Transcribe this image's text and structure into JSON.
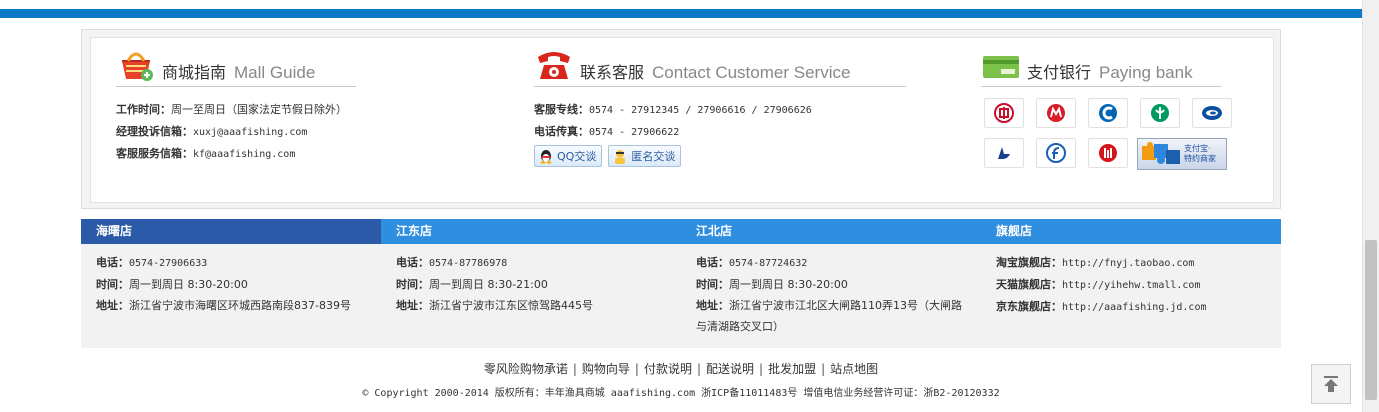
{
  "guide": {
    "title_cn": "商城指南",
    "title_en": "Mall Guide",
    "rows": [
      {
        "label": "工作时间：",
        "value": "周一至周日（国家法定节假日除外）"
      },
      {
        "label": "经理投诉信箱：",
        "value": "xuxj@aaafishing.com"
      },
      {
        "label": "客服服务信箱：",
        "value": "kf@aaafishing.com"
      }
    ]
  },
  "service": {
    "title_cn": "联系客服",
    "title_en": "Contact Customer Service",
    "rows": [
      {
        "label": "客服专线：",
        "value": "0574 - 27912345 / 27906616 / 27906626"
      },
      {
        "label": "电话传真：",
        "value": "0574 - 27906622"
      }
    ],
    "qq_button": "QQ交谈",
    "anon_button": "匿名交谈"
  },
  "pay": {
    "title_cn": "支付银行",
    "title_en": "Paying bank",
    "alipay_line1": "支付宝·",
    "alipay_line2": "特约商家"
  },
  "stores": {
    "tabs": [
      "海曙店",
      "江东店",
      "江北店",
      "旗舰店"
    ],
    "haishu": {
      "phone_label": "电话：",
      "phone": "0574-27906633",
      "time_label": "时间：",
      "time": "周一到周日 8:30-20:00",
      "addr_label": "地址：",
      "addr": "浙江省宁波市海曙区环城西路南段837-839号"
    },
    "jiangdong": {
      "phone_label": "电话：",
      "phone": "0574-87786978",
      "time_label": "时间：",
      "time": "周一到周日 8:30-21:00",
      "addr_label": "地址：",
      "addr": "浙江省宁波市江东区惊驾路445号"
    },
    "jiangbei": {
      "phone_label": "电话：",
      "phone": "0574-87724632",
      "time_label": "时间：",
      "time": "周一到周日 8:30-20:00",
      "addr_label": "地址：",
      "addr": "浙江省宁波市江北区大闸路110弄13号（大闸路与清湖路交叉口）"
    },
    "flagship": {
      "taobao_label": "淘宝旗舰店：",
      "taobao": "http://fnyj.taobao.com",
      "tmall_label": "天猫旗舰店：",
      "tmall": "http://yihehw.tmall.com",
      "jd_label": "京东旗舰店：",
      "jd": "http://aaafishing.jd.com"
    }
  },
  "footer": {
    "links": [
      "零风险购物承诺",
      "购物向导",
      "付款说明",
      "配送说明",
      "批发加盟",
      "站点地图"
    ],
    "separator": "|",
    "copyright": "© Copyright 2000-2014 版权所有：丰年渔具商城 aaafishing.com 浙ICP备11011483号 增值电信业务经营许可证：浙B2-20120332"
  },
  "colors": {
    "topbar": "#0b7ac7",
    "tab_active": "#2b5aa8",
    "tab": "#2f8ee0"
  }
}
